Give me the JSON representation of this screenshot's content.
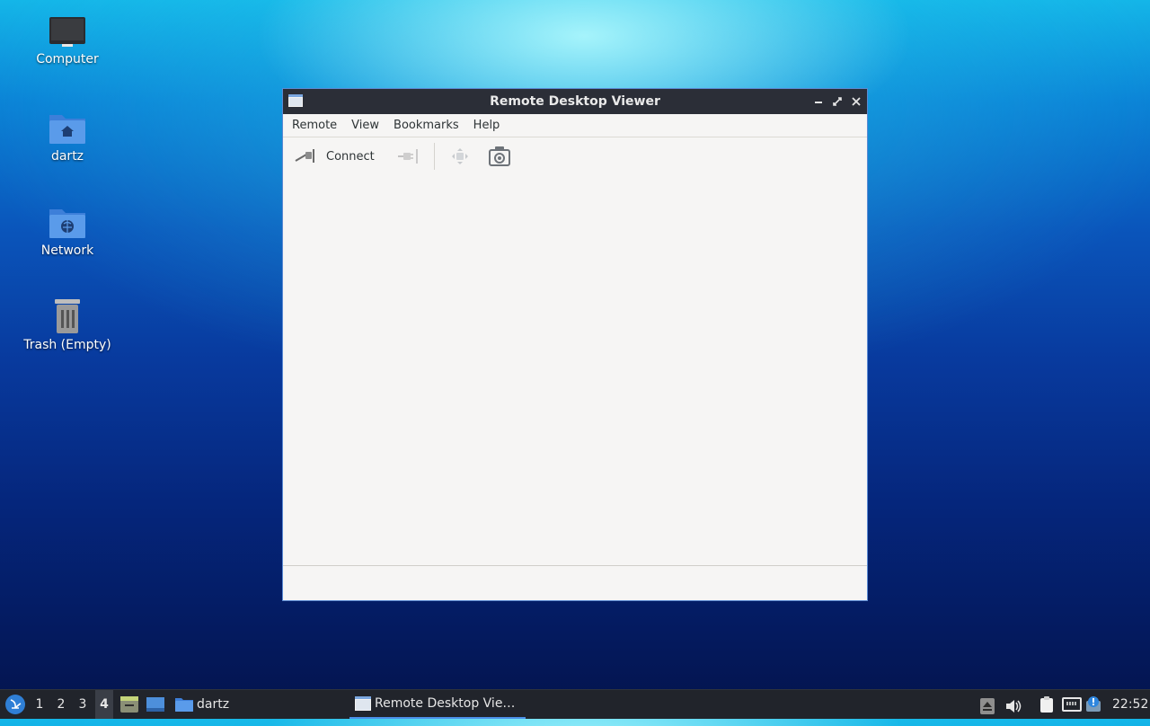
{
  "desktop": {
    "icons": [
      {
        "label": "Computer"
      },
      {
        "label": "dartz"
      },
      {
        "label": "Network"
      },
      {
        "label": "Trash (Empty)"
      }
    ]
  },
  "window": {
    "title": "Remote Desktop Viewer",
    "menus": [
      "Remote",
      "View",
      "Bookmarks",
      "Help"
    ],
    "toolbar": {
      "connect_label": "Connect"
    }
  },
  "taskbar": {
    "workspaces": [
      "1",
      "2",
      "3",
      "4"
    ],
    "active_workspace": "4",
    "folder_label": "dartz",
    "task_label": "Remote Desktop Vie…",
    "clock": "22:52"
  },
  "colors": {
    "titlebar": "#2b2e37",
    "taskbar": "#21242b",
    "accent": "#4c8fe8",
    "window_bg": "#f6f5f4"
  }
}
